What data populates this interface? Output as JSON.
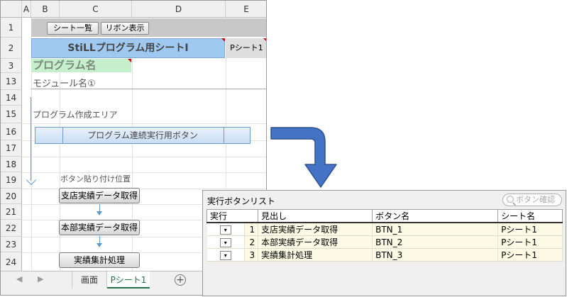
{
  "sheet": {
    "columns": [
      "A",
      "B",
      "C",
      "D",
      "E"
    ],
    "rows": [
      "1",
      "2",
      "3",
      "13",
      "14",
      "15",
      "16",
      "17",
      "18",
      "19",
      "20",
      "21",
      "22",
      "23",
      "24"
    ],
    "buttons": {
      "sheet_list": "シート一覧",
      "ribbon": "リボン表示"
    },
    "title": "StiLLプログラム用シートⅠ",
    "sheet_tag": "Pシート1",
    "program_name": "プログラム名",
    "module_name": "モジュール名①",
    "area_label": "プログラム作成エリア",
    "continuous_button": "プログラム連続実行用ボタン",
    "paste_label": "ボタン貼り付け位置",
    "proc_buttons": [
      "支店実績データ取得",
      "本部実績データ取得",
      "実績集計処理"
    ],
    "tabs": {
      "screen": "画面",
      "psheet": "Pシート1"
    },
    "nav_prev": "◀",
    "nav_next": "▶",
    "add_sheet": "+"
  },
  "dialog": {
    "title": "実行ボタンリスト",
    "search_placeholder": "ボタン確認",
    "headers": [
      "実行",
      "見出し",
      "ボタン名",
      "シート名"
    ],
    "rows": [
      {
        "no": "1",
        "heading": "支店実績データ取得",
        "button": "BTN_1",
        "sheet": "Pシート1"
      },
      {
        "no": "2",
        "heading": "本部実績データ取得",
        "button": "BTN_2",
        "sheet": "Pシート1"
      },
      {
        "no": "3",
        "heading": "実績集計処理",
        "button": "BTN_3",
        "sheet": "Pシート1"
      }
    ],
    "dropdown_glyph": "▾"
  },
  "colors": {
    "arrow": "#4472c4",
    "accent_blue": "#9fc9f0",
    "green": "#c6efce",
    "tab_active": "#217346"
  }
}
